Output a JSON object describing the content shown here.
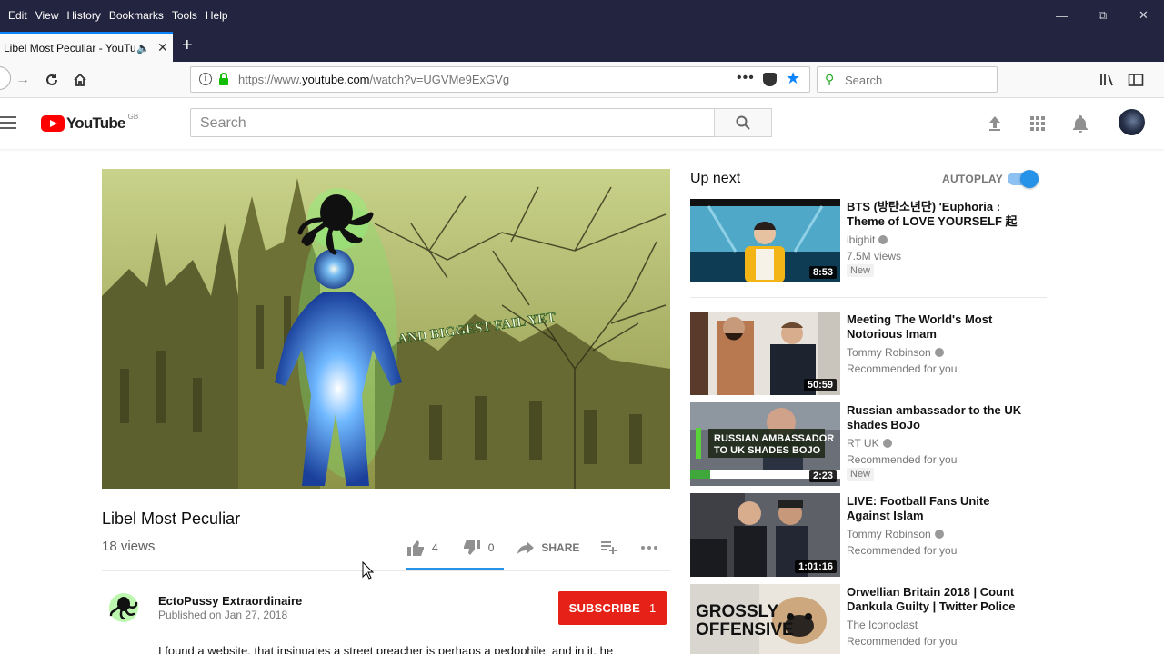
{
  "browser": {
    "menus": [
      "Edit",
      "View",
      "History",
      "Bookmarks",
      "Tools",
      "Help"
    ],
    "tab_title": "Libel Most Peculiar - YouTube",
    "url_prefix": "https://www.",
    "url_host": "youtube.com",
    "url_path": "/watch?v=UGVMe9ExGVg",
    "search_placeholder": "Search",
    "accent": "#0a84ff",
    "chrome_bg": "#23243f"
  },
  "youtube": {
    "logo_text": "YouTube",
    "region": "GB",
    "search_placeholder": "Search",
    "brand_red": "#ff0000"
  },
  "video": {
    "overlay_text": "AND BIGGEST FAIL YET",
    "title": "Libel Most Peculiar",
    "views": "18 views",
    "likes": "4",
    "dislikes": "0",
    "share_label": "SHARE",
    "channel": "EctoPussy Extraordinaire",
    "published": "Published on Jan 27, 2018",
    "subscribe_label": "SUBSCRIBE",
    "subscribe_count": "1",
    "description_start": "I found a website, that insinuates a street preacher is perhaps a pedophile, and in it, he"
  },
  "sidebar": {
    "up_next": "Up next",
    "autoplay": "AUTOPLAY",
    "autoplay_on": true,
    "items": [
      {
        "title": "BTS (방탄소년단) 'Euphoria : Theme of LOVE YOURSELF 起",
        "channel": "ibighit",
        "meta": "7.5M views",
        "badge": "New",
        "duration": "8:53"
      },
      {
        "title": "Meeting The World's Most Notorious Imam",
        "channel": "Tommy Robinson",
        "meta": "Recommended for you",
        "duration": "50:59"
      },
      {
        "title": "Russian ambassador to the UK shades BoJo",
        "channel": "RT UK",
        "meta": "Recommended for you",
        "badge": "New",
        "duration": "2:23",
        "thumb_text": "RUSSIAN AMBASSADOR TO UK SHADES BOJO"
      },
      {
        "title": "LIVE: Football Fans Unite Against Islam",
        "channel": "Tommy Robinson",
        "meta": "Recommended for you",
        "duration": "1:01:16"
      },
      {
        "title": "Orwellian Britain 2018 | Count Dankula Guilty | Twitter Police",
        "channel": "The Iconoclast",
        "meta": "Recommended for you",
        "thumb_text": "GROSSLY OFFENSIVE"
      }
    ]
  }
}
